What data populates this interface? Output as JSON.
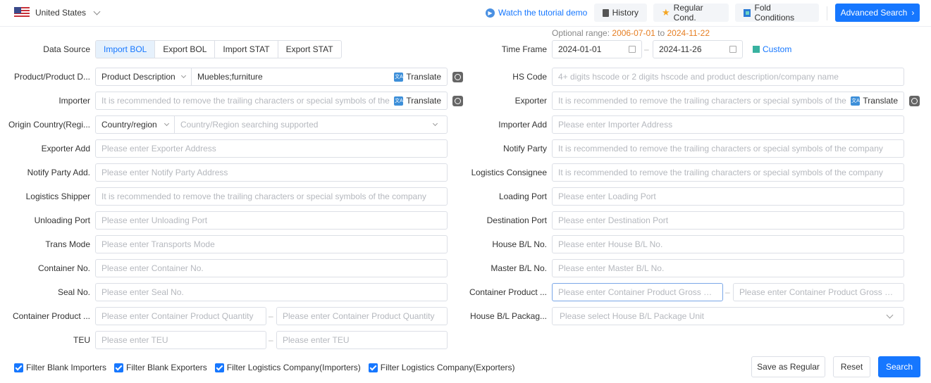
{
  "topbar": {
    "country": "United States",
    "tutorial": "Watch the tutorial demo",
    "history": "History",
    "regular": "Regular Cond.",
    "fold": "Fold Conditions",
    "advanced": "Advanced Search",
    "accent": "#1677ff"
  },
  "range": {
    "label": "Optional range:",
    "from": "2006-07-01",
    "to_word": "to",
    "to": "2024-11-22"
  },
  "data_source": {
    "label": "Data Source",
    "options": [
      "Import BOL",
      "Export BOL",
      "Import STAT",
      "Export STAT"
    ],
    "selected": "Import BOL"
  },
  "time_frame": {
    "label": "Time Frame",
    "start": "2024-01-01",
    "end": "2024-11-26",
    "sep": "–",
    "custom": "Custom"
  },
  "translate": "Translate",
  "range_sep": "–",
  "left_fields": {
    "product": {
      "label": "Product/Product D...",
      "select": "Product Description",
      "value": "Muebles;furniture"
    },
    "importer": {
      "label": "Importer",
      "placeholder": "It is recommended to remove the trailing characters or special symbols of the company"
    },
    "origin": {
      "label": "Origin Country(Regi...",
      "select": "Country/region",
      "placeholder": "Country/Region searching supported"
    },
    "exporter_add": {
      "label": "Exporter Add",
      "placeholder": "Please enter Exporter Address"
    },
    "notify_add": {
      "label": "Notify Party Add.",
      "placeholder": "Please enter Notify Party Address"
    },
    "shipper": {
      "label": "Logistics Shipper",
      "placeholder": "It is recommended to remove the trailing characters or special symbols of the company"
    },
    "unloading": {
      "label": "Unloading Port",
      "placeholder": "Please enter Unloading Port"
    },
    "trans_mode": {
      "label": "Trans Mode",
      "placeholder": "Please enter Transports Mode"
    },
    "container_no": {
      "label": "Container No.",
      "placeholder": "Please enter Container No."
    },
    "seal_no": {
      "label": "Seal No.",
      "placeholder": "Please enter Seal No."
    },
    "container_qty": {
      "label": "Container Product ...",
      "placeholder_min": "Please enter Container Product Quantity",
      "placeholder_max": "Please enter Container Product Quantity"
    },
    "teu": {
      "label": "TEU",
      "placeholder_min": "Please enter TEU",
      "placeholder_max": "Please enter TEU"
    }
  },
  "right_fields": {
    "hs_code": {
      "label": "HS Code",
      "placeholder": "4+ digits hscode or 2 digits hscode and product description/company name"
    },
    "exporter": {
      "label": "Exporter",
      "placeholder": "It is recommended to remove the trailing characters or special symbols of the company"
    },
    "importer_add": {
      "label": "Importer Add",
      "placeholder": "Please enter Importer Address"
    },
    "notify_party": {
      "label": "Notify Party",
      "placeholder": "It is recommended to remove the trailing characters or special symbols of the company"
    },
    "consignee": {
      "label": "Logistics Consignee",
      "placeholder": "It is recommended to remove the trailing characters or special symbols of the company"
    },
    "loading": {
      "label": "Loading Port",
      "placeholder": "Please enter Loading Port"
    },
    "destination": {
      "label": "Destination Port",
      "placeholder": "Please enter Destination Port"
    },
    "house_bl": {
      "label": "House B/L No.",
      "placeholder": "Please enter House B/L No."
    },
    "master_bl": {
      "label": "Master B/L No.",
      "placeholder": "Please enter Master B/L No."
    },
    "gross_weight": {
      "label": "Container Product ...",
      "placeholder_min": "Please enter Container Product Gross Weight",
      "placeholder_max": "Please enter Container Product Gross Weight"
    },
    "package_unit": {
      "label": "House B/L Packag...",
      "placeholder": "Please select House B/L Package Unit"
    }
  },
  "filters": [
    {
      "label": "Filter Blank Importers",
      "checked": true
    },
    {
      "label": "Filter Blank Exporters",
      "checked": true
    },
    {
      "label": "Filter Logistics Company(Importers)",
      "checked": true
    },
    {
      "label": "Filter Logistics Company(Exporters)",
      "checked": true
    }
  ],
  "actions": {
    "save": "Save as Regular",
    "reset": "Reset",
    "search": "Search"
  }
}
